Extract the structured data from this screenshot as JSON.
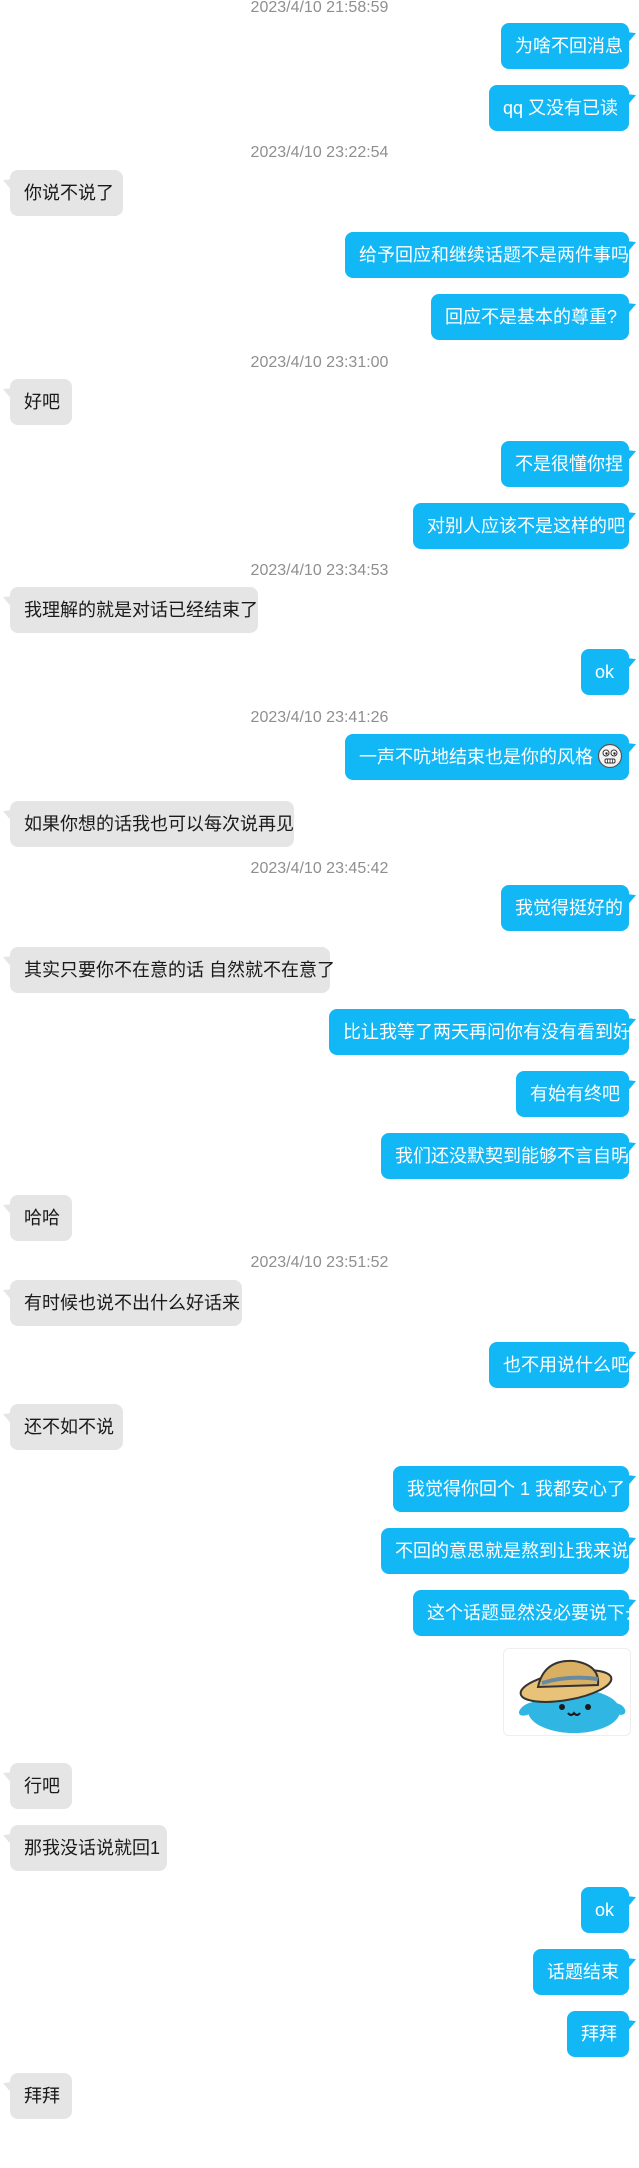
{
  "colors": {
    "outgoing_bubble": "#12b7f5",
    "incoming_bubble": "#e5e5e5",
    "timestamp_text": "#8f8f8f"
  },
  "messages": [
    {
      "type": "timestamp",
      "text": "2023/4/10 21:58:59"
    },
    {
      "type": "msg",
      "dir": "out",
      "text": "为啥不回消息"
    },
    {
      "type": "msg",
      "dir": "out",
      "text": "qq 又没有已读"
    },
    {
      "type": "timestamp",
      "text": "2023/4/10 23:22:54"
    },
    {
      "type": "msg",
      "dir": "in",
      "text": "你说不说了"
    },
    {
      "type": "msg",
      "dir": "out",
      "text": "给予回应和继续话题不是两件事吗"
    },
    {
      "type": "msg",
      "dir": "out",
      "text": "回应不是基本的尊重?"
    },
    {
      "type": "timestamp",
      "text": "2023/4/10 23:31:00"
    },
    {
      "type": "msg",
      "dir": "in",
      "text": "好吧"
    },
    {
      "type": "msg",
      "dir": "out",
      "text": "不是很懂你捏"
    },
    {
      "type": "msg",
      "dir": "out",
      "text": "对别人应该不是这样的吧"
    },
    {
      "type": "timestamp",
      "text": "2023/4/10 23:34:53"
    },
    {
      "type": "msg",
      "dir": "in",
      "text": "我理解的就是对话已经结束了"
    },
    {
      "type": "msg",
      "dir": "out",
      "text": "ok"
    },
    {
      "type": "timestamp",
      "text": "2023/4/10 23:41:26"
    },
    {
      "type": "msg",
      "dir": "out",
      "text": "一声不吭地结束也是你的风格",
      "emoji": "grimace-face-emoji"
    },
    {
      "type": "msg",
      "dir": "in",
      "text": "如果你想的话我也可以每次说再见"
    },
    {
      "type": "timestamp",
      "text": "2023/4/10 23:45:42"
    },
    {
      "type": "msg",
      "dir": "out",
      "text": "我觉得挺好的"
    },
    {
      "type": "msg",
      "dir": "in",
      "text": "其实只要你不在意的话 自然就不在意了"
    },
    {
      "type": "msg",
      "dir": "out",
      "text": "比让我等了两天再问你有没有看到好"
    },
    {
      "type": "msg",
      "dir": "out",
      "text": "有始有终吧"
    },
    {
      "type": "msg",
      "dir": "out",
      "text": "我们还没默契到能够不言自明"
    },
    {
      "type": "msg",
      "dir": "in",
      "text": "哈哈"
    },
    {
      "type": "timestamp",
      "text": "2023/4/10 23:51:52"
    },
    {
      "type": "msg",
      "dir": "in",
      "text": "有时候也说不出什么好话来"
    },
    {
      "type": "msg",
      "dir": "out",
      "text": "也不用说什么吧"
    },
    {
      "type": "msg",
      "dir": "in",
      "text": "还不如不说"
    },
    {
      "type": "msg",
      "dir": "out",
      "text": "我觉得你回个 1 我都安心了"
    },
    {
      "type": "msg",
      "dir": "out",
      "text": "不回的意思就是熬到让我来说"
    },
    {
      "type": "msg",
      "dir": "out",
      "text": "这个话题显然没必要说下去"
    },
    {
      "type": "sticker",
      "dir": "out",
      "icon": "blue-creature-with-hat-sticker"
    },
    {
      "type": "msg",
      "dir": "in",
      "text": "行吧"
    },
    {
      "type": "msg",
      "dir": "in",
      "text": "那我没话说就回1"
    },
    {
      "type": "msg",
      "dir": "out",
      "text": "ok"
    },
    {
      "type": "msg",
      "dir": "out",
      "text": "话题结束"
    },
    {
      "type": "msg",
      "dir": "out",
      "text": "拜拜"
    },
    {
      "type": "msg",
      "dir": "in",
      "text": "拜拜"
    }
  ]
}
